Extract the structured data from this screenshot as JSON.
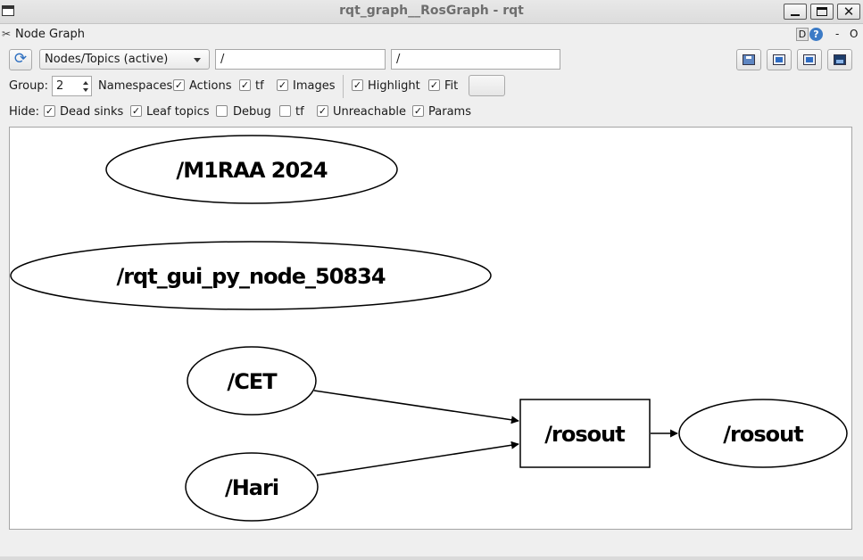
{
  "window": {
    "title": "rqt_graph__RosGraph - rqt",
    "close_glyph": "✕"
  },
  "plugin": {
    "title": "Node Graph",
    "d_label": "D",
    "help_label": "?",
    "dash_label": "-",
    "o_label": "O"
  },
  "toolbar": {
    "refresh_glyph": "⟳",
    "mode_value": "Nodes/Topics (active)",
    "node_filter_value": "/",
    "topic_filter_value": "/"
  },
  "options": {
    "group_label": "Group:",
    "group_value": "2",
    "namespaces_label": "Namespaces",
    "actions_label": "Actions",
    "tf_label": "tf",
    "images_label": "Images",
    "highlight_label": "Highlight",
    "fit_label": "Fit",
    "namespaces_checked": true,
    "actions_checked": true,
    "tf_checked": true,
    "images_checked": true,
    "highlight_checked": true,
    "fit_checked": true
  },
  "hide": {
    "label": "Hide:",
    "dead_sinks_label": "Dead sinks",
    "leaf_topics_label": "Leaf topics",
    "debug_label": "Debug",
    "tf_label": "tf",
    "unreachable_label": "Unreachable",
    "params_label": "Params",
    "dead_sinks_checked": true,
    "leaf_topics_checked": true,
    "debug_checked": false,
    "tf_checked": false,
    "unreachable_checked": true,
    "params_checked": true
  },
  "graph": {
    "nodes": {
      "m1raa": "/M1RAA 2024",
      "rqt_gui": "/rqt_gui_py_node_50834",
      "cet": "/CET",
      "hari": "/Hari",
      "rosout_node": "/rosout"
    },
    "topics": {
      "rosout_topic": "/rosout"
    }
  }
}
